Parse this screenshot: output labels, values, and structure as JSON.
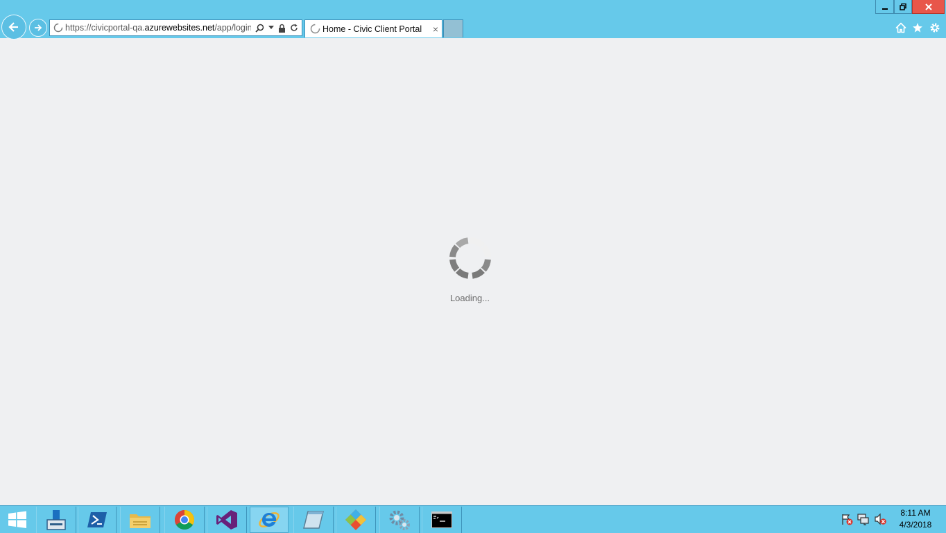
{
  "browser": {
    "address": {
      "url_prefix": "https://civicportal-qa.",
      "url_host": "azurewebsites.net",
      "url_suffix": "/app/login"
    },
    "tab": {
      "title": "Home - Civic Client Portal",
      "close_glyph": "×"
    },
    "window_controls": {
      "minimize": "minimize-icon",
      "maximize": "restore-icon",
      "close": "close-icon"
    },
    "right_icons": [
      "home-icon",
      "favorites-star-icon",
      "settings-gear-icon"
    ]
  },
  "page": {
    "loading_text": "Loading..."
  },
  "taskbar": {
    "items": [
      {
        "name": "start-button",
        "icon": "windows-logo-icon"
      },
      {
        "name": "server-manager",
        "icon": "server-manager-icon"
      },
      {
        "name": "powershell",
        "icon": "powershell-icon"
      },
      {
        "name": "file-explorer",
        "icon": "folder-icon"
      },
      {
        "name": "chrome",
        "icon": "chrome-icon"
      },
      {
        "name": "visual-studio",
        "icon": "visual-studio-icon"
      },
      {
        "name": "internet-explorer",
        "icon": "internet-explorer-icon"
      },
      {
        "name": "notepad",
        "icon": "notepad-icon"
      },
      {
        "name": "git",
        "icon": "git-icon"
      },
      {
        "name": "services",
        "icon": "gears-icon"
      },
      {
        "name": "command-prompt",
        "icon": "cmd-icon"
      }
    ],
    "clock": {
      "time": "8:11 AM",
      "date": "4/3/2018"
    },
    "colors": {
      "bar": "#66c9ea",
      "close": "#e8564a"
    }
  }
}
